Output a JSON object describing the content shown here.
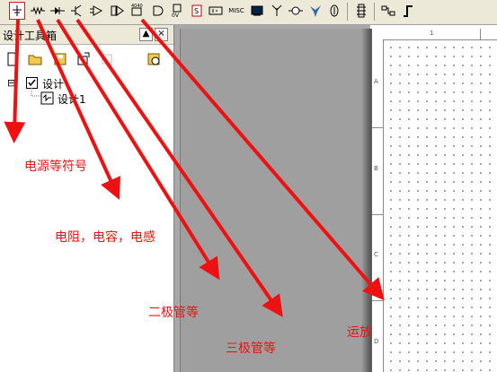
{
  "toolbar": {
    "misc_label": "MISC",
    "buttons": [
      "power-symbol",
      "resistor",
      "diode",
      "transistor",
      "opamp",
      "op-amp-alt",
      "counter",
      "logic-gate",
      "chip-ov",
      "chip-s",
      "battery",
      "misc",
      "display",
      "antenna",
      "crystal",
      "special",
      "connector",
      "header",
      "wire-switch",
      "pulse"
    ]
  },
  "panel": {
    "title": "设计工具箱",
    "pin_glyph": "▲",
    "close_glyph": "×",
    "tree": {
      "root": "设计",
      "child": "设计1",
      "expander": "⊟"
    }
  },
  "sheet": {
    "zones": [
      "A",
      "B",
      "C",
      "D"
    ],
    "top_label": "1"
  },
  "annotations": {
    "power": "电源等符号",
    "passive": "电阻，电容，电感",
    "diode": "二极管等",
    "transistor": "三极管等",
    "opamp": "运放"
  },
  "colors": {
    "accent": "#ee1111",
    "toolbar_bg": "#ece9d8",
    "workspace": "#a8a8a8"
  }
}
